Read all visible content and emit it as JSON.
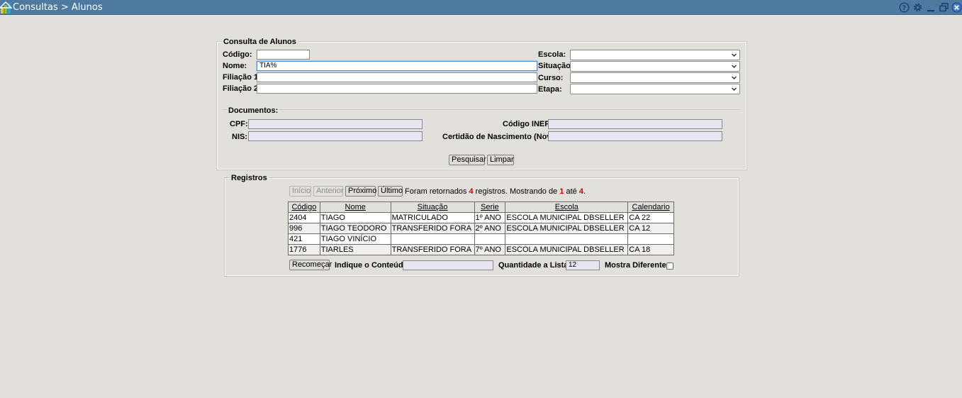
{
  "titlebar": {
    "breadcrumb": "Consultas > Alunos",
    "icons": [
      "app-logo-icon",
      "help-icon",
      "gear-icon",
      "minimize-icon",
      "restore-icon",
      "close-icon"
    ],
    "colors": {
      "bar": "#4f7aa0",
      "close": "#3c7bd1"
    }
  },
  "form": {
    "legend": "Consulta de Alunos",
    "codigo_label": "Código:",
    "codigo_value": "",
    "nome_label": "Nome:",
    "nome_value": "TIA%",
    "filiacao1_label": "Filiação 1:",
    "filiacao1_value": "",
    "filiacao2_label": "Filiação 2:",
    "filiacao2_value": "",
    "escola_label": "Escola:",
    "escola_value": "",
    "situacao_label": "Situação:",
    "situacao_value": "",
    "curso_label": "Curso:",
    "curso_value": "",
    "etapa_label": "Etapa:",
    "etapa_value": "",
    "documentos_legend": "Documentos:",
    "cpf_label": "CPF:",
    "cpf_value": "",
    "nis_label": "NIS:",
    "nis_value": "",
    "inep_label": "Código INEP:",
    "inep_value": "",
    "certidao_label": "Certidão de Nascimento (Nova):",
    "certidao_value": "",
    "pesquisar_label": "Pesquisar",
    "limpar_label": "Limpar"
  },
  "results": {
    "legend": "Registros",
    "nav": {
      "inicio": "Início",
      "anterior": "Anterior",
      "proximo": "Próximo",
      "ultimo": "Último"
    },
    "info": {
      "prefix": "Foram retornados ",
      "total": "4",
      "middle": " registros. Mostrando de ",
      "from": "1",
      "until": " até ",
      "to": "4",
      "suffix": "."
    },
    "columns": [
      "Código",
      "Nome",
      "Situação",
      "Serie",
      "Escola",
      "Calendario"
    ],
    "rows": [
      [
        "2404",
        "TIAGO",
        "MATRICULADO",
        "1º ANO",
        "ESCOLA MUNICIPAL DBSELLER",
        "CA 22"
      ],
      [
        "996",
        "TIAGO TEODORO",
        "TRANSFERIDO FORA",
        "2º ANO",
        "ESCOLA MUNICIPAL DBSELLER",
        "CA 12"
      ],
      [
        "421",
        "TIAGO VINÍCIO",
        "",
        "",
        "",
        ""
      ],
      [
        "1776",
        "TIARLES",
        "TRANSFERIDO FORA",
        "7º ANO",
        "ESCOLA MUNICIPAL DBSELLER",
        "CA 18"
      ]
    ],
    "footer": {
      "recomecar_label": "Recomeçar",
      "conteudo_label": "Indique o Conteúdo:",
      "conteudo_value": "",
      "quantidade_label": "Quantidade a Listar:",
      "quantidade_value": "12",
      "diferentes_label": "Mostra Diferentes:",
      "diferentes_checked": false
    }
  }
}
